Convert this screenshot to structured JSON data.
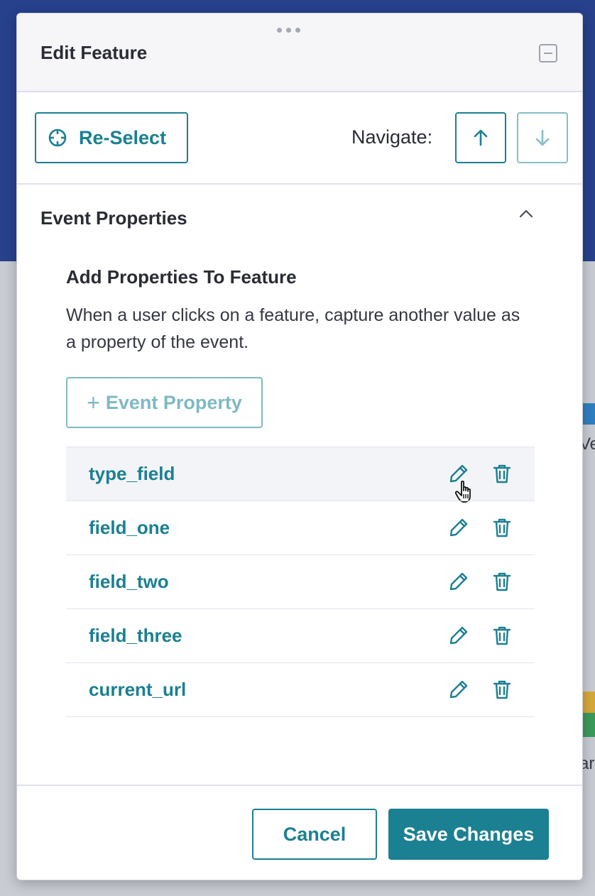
{
  "modal": {
    "title": "Edit Feature",
    "reselect_label": "Re-Select",
    "navigate_label": "Navigate:"
  },
  "section": {
    "title": "Event Properties",
    "subtitle": "Add Properties To Feature",
    "description": "When a user clicks on a feature, capture another value as a property of the event.",
    "add_button_label": "Event Property"
  },
  "properties": [
    {
      "name": "type_field"
    },
    {
      "name": "field_one"
    },
    {
      "name": "field_two"
    },
    {
      "name": "field_three"
    },
    {
      "name": "current_url"
    }
  ],
  "footer": {
    "cancel_label": "Cancel",
    "save_label": "Save Changes"
  },
  "colors": {
    "accent": "#1b8091",
    "accent_light": "#7fb9c2",
    "header_bg": "#f6f6f8",
    "hover_row": "#f3f4f7"
  },
  "icons": {
    "drag": "drag-handle-icon",
    "minimize": "minimize-icon",
    "crosshair": "crosshair-icon",
    "arrow_up": "arrow-up-icon",
    "arrow_down": "arrow-down-icon",
    "chevron": "chevron-up-icon",
    "plus": "plus-icon",
    "edit": "pencil-icon",
    "delete": "trash-icon",
    "cursor": "hand-pointer-icon"
  },
  "background": {
    "partial_text_1": "Ve",
    "partial_text_2": "ar"
  }
}
